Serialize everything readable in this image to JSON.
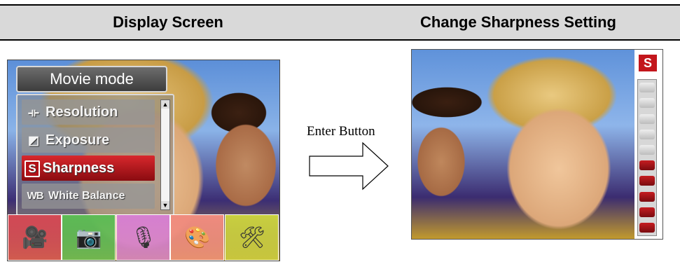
{
  "table": {
    "col1_header": "Display Screen",
    "col2_header": "Change Sharpness Setting"
  },
  "left_screen": {
    "menu_title": "Movie mode",
    "menu_items": [
      {
        "label": "Resolution",
        "icon": "resolution-icon",
        "icon_glyph": "⟛",
        "selected": false
      },
      {
        "label": "Exposure",
        "icon": "exposure-icon",
        "icon_glyph": "◩",
        "selected": false
      },
      {
        "label": "Sharpness",
        "icon": "sharpness-icon",
        "icon_glyph": "S",
        "selected": true
      },
      {
        "label": "White Balance",
        "icon": "white-balance-icon",
        "icon_glyph": "WB",
        "selected": false
      }
    ],
    "mode_tabs": [
      {
        "name": "movie-camera-icon",
        "glyph": "🎥",
        "color": "#d34a55",
        "selected": true
      },
      {
        "name": "camera-icon",
        "glyph": "📷",
        "color": "#5dbb55"
      },
      {
        "name": "microphone-icon",
        "glyph": "🎙",
        "color": "#d57fd0"
      },
      {
        "name": "palette-icon",
        "glyph": "🎨",
        "color": "#f08c7e"
      },
      {
        "name": "tools-icon",
        "glyph": "🛠",
        "color": "#c9cf3f"
      }
    ]
  },
  "arrow": {
    "label": "Enter Button"
  },
  "right_screen": {
    "sharpness_badge": "S",
    "sharpness_level_segments": 10,
    "sharpness_level_active": 5,
    "active_color": "#c61d21",
    "inactive_color": "#eeeeee"
  }
}
